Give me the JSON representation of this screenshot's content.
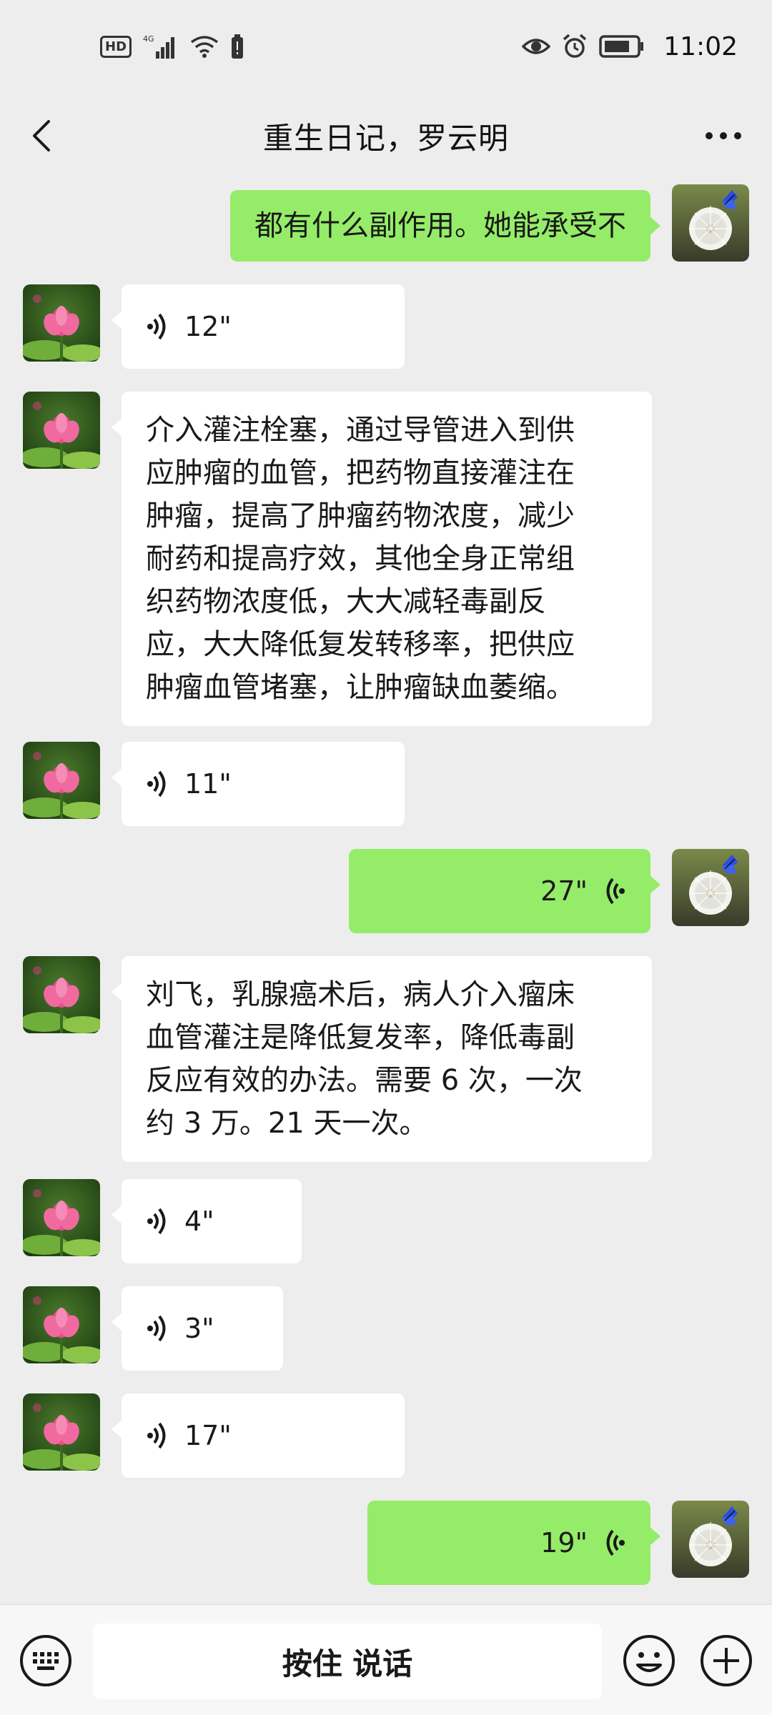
{
  "status_bar": {
    "hd_label": "HD",
    "network_label": "4G",
    "time": "11:02"
  },
  "nav": {
    "title": "重生日记，罗云明",
    "back_icon": "chevron-left-icon",
    "more_icon": "more-dots-icon"
  },
  "colors": {
    "sent_bubble": "#95ec69",
    "received_bubble": "#ffffff",
    "background": "#ededed"
  },
  "messages": [
    {
      "side": "right",
      "type": "text",
      "text": "都有什么副作用。她能承受不"
    },
    {
      "side": "left",
      "type": "voice",
      "duration": "12\""
    },
    {
      "side": "left",
      "type": "text",
      "lines": [
        "介入灌注栓塞，通过导管进入到供",
        "应肿瘤的血管，把药物直接灌注在",
        "肿瘤，提高了肿瘤药物浓度，减少",
        "耐药和提高疗效，其他全身正常组",
        "织药物浓度低，大大减轻毒副反",
        "应，大大降低复发转移率，把供应",
        "肿瘤血管堵塞，让肿瘤缺血萎缩。"
      ]
    },
    {
      "side": "left",
      "type": "voice",
      "duration": "11\""
    },
    {
      "side": "right",
      "type": "voice",
      "duration": "27\""
    },
    {
      "side": "left",
      "type": "text",
      "lines": [
        "刘飞，乳腺癌术后，病人介入瘤床",
        "血管灌注是降低复发率，降低毒副",
        "反应有效的办法。需要 6 次，一次",
        "约 3 万。21 天一次。"
      ]
    },
    {
      "side": "left",
      "type": "voice",
      "duration": "4\""
    },
    {
      "side": "left",
      "type": "voice",
      "duration": "3\""
    },
    {
      "side": "left",
      "type": "voice",
      "duration": "17\""
    },
    {
      "side": "right",
      "type": "voice",
      "duration": "19\""
    }
  ],
  "input_bar": {
    "hold_to_talk": "按住 说话",
    "keyboard_icon": "keyboard-icon",
    "emoji_icon": "emoji-icon",
    "plus_icon": "plus-icon"
  }
}
